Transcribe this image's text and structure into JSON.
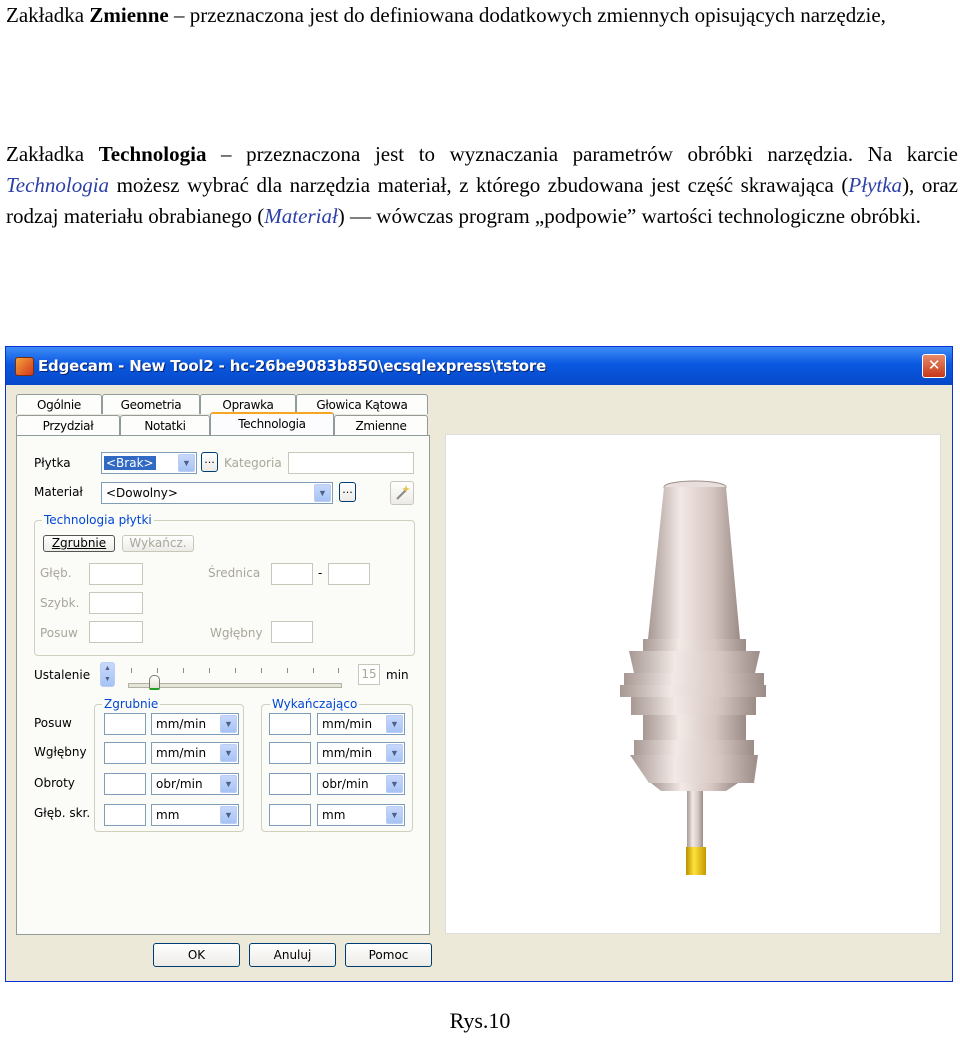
{
  "paragraphs": {
    "p1": {
      "a": "Zakładka ",
      "b": "Zmienne",
      "c": " – przeznaczona jest do definiowana dodatkowych zmiennych opisujących narzędzie,"
    },
    "p2": {
      "a": "Zakładka ",
      "b": "Technologia",
      "c": " – przeznaczona jest to wyznaczania parametrów obróbki narzędzia. Na karcie ",
      "d": "Technologia",
      "e": " możesz wybrać dla narzędzia materiał, z którego zbudowana jest część skrawająca (",
      "f": "Płytka",
      "g": "), oraz rodzaj materiału obrabianego (",
      "h": "Materiał",
      "i": ") — wówczas program „podpowie” wartości technologiczne obróbki."
    }
  },
  "window": {
    "title": "Edgecam - New Tool2 - hc-26be9083b850\\ecsqlexpress\\tstore",
    "close": "✕"
  },
  "tabs": {
    "row1": [
      "Ogólnie",
      "Geometria",
      "Oprawka",
      "Głowica Kątowa"
    ],
    "row2": [
      "Przydział",
      "Notatki",
      "Technologia",
      "Zmienne"
    ]
  },
  "form": {
    "plytka_label": "Płytka",
    "plytka_value": "<Brak>",
    "kategoria_label": "Kategoria",
    "material_label": "Materiał",
    "material_value": "<Dowolny>",
    "ellipsis": "...",
    "group_tech_title": "Technologia płytki",
    "zgrubnie_btn": "Zgrubnie",
    "wykancz_btn": "Wykańcz.",
    "gleb_label": "Głęb.",
    "srednica_label": "Średnica",
    "dash": "-",
    "szybk_label": "Szybk.",
    "posuw_dis_label": "Posuw",
    "wglebny_dis_label": "Wgłębny",
    "ustalenie_label": "Ustalenie",
    "ustalenie_value": "15",
    "ustalenie_unit": "min",
    "group_zgrubnie": "Zgrubnie",
    "group_wykanczajaco": "Wykańczająco",
    "rows": [
      {
        "label": "Posuw",
        "unit_left": "mm/min",
        "unit_right": "mm/min"
      },
      {
        "label": "Wgłębny",
        "unit_left": "mm/min",
        "unit_right": "mm/min"
      },
      {
        "label": "Obroty",
        "unit_left": "obr/min",
        "unit_right": "obr/min"
      },
      {
        "label": "Głęb. skr.",
        "unit_left": "mm",
        "unit_right": "mm"
      }
    ]
  },
  "buttons": {
    "ok": "OK",
    "cancel": "Anuluj",
    "help": "Pomoc"
  },
  "caption": "Rys.10",
  "colors": {
    "titlebar": "#0a58e0",
    "tool_body": "#d9c7c2",
    "tool_tip": "#e6c000"
  }
}
